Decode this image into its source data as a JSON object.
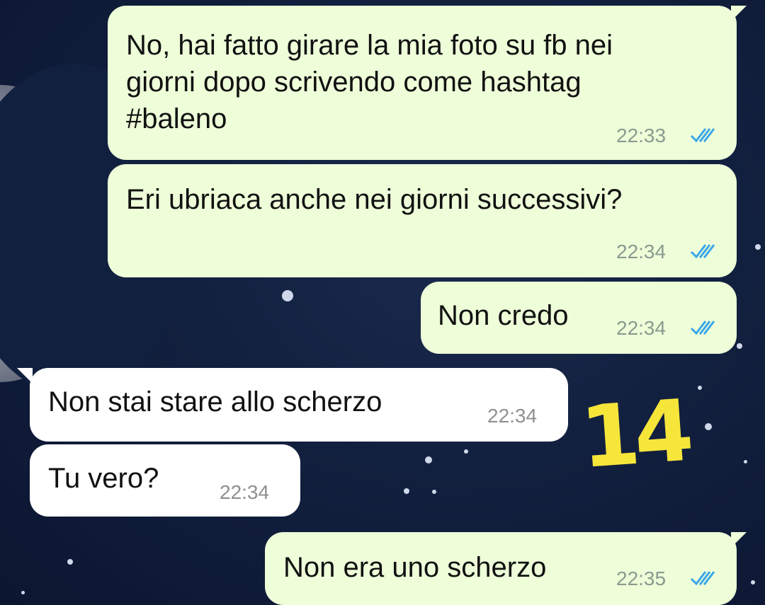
{
  "colors": {
    "outgoing_bubble": "#eefed9",
    "incoming_bubble": "#ffffff",
    "read_ticks": "#3aa6e8",
    "sticker": "#f6e63a"
  },
  "messages": [
    {
      "direction": "out",
      "text_lines": [
        "No, hai fatto girare la mia foto su fb nei",
        "giorni dopo scrivendo come hashtag",
        "#baleno"
      ],
      "time": "22:33",
      "status_icon": "double-check-icon"
    },
    {
      "direction": "out",
      "text_lines": [
        "Eri ubriaca anche nei giorni successivi?"
      ],
      "time": "22:34",
      "status_icon": "double-check-icon"
    },
    {
      "direction": "out",
      "text_lines": [
        "Non credo"
      ],
      "time": "22:34",
      "status_icon": "double-check-icon"
    },
    {
      "direction": "in",
      "text_lines": [
        "Non stai stare allo scherzo"
      ],
      "time": "22:34"
    },
    {
      "direction": "in",
      "text_lines": [
        "Tu vero?"
      ],
      "time": "22:34"
    },
    {
      "direction": "out",
      "text_lines": [
        "Non era uno scherzo"
      ],
      "time": "22:35",
      "status_icon": "double-check-icon"
    }
  ],
  "annotation": {
    "text": "14"
  }
}
